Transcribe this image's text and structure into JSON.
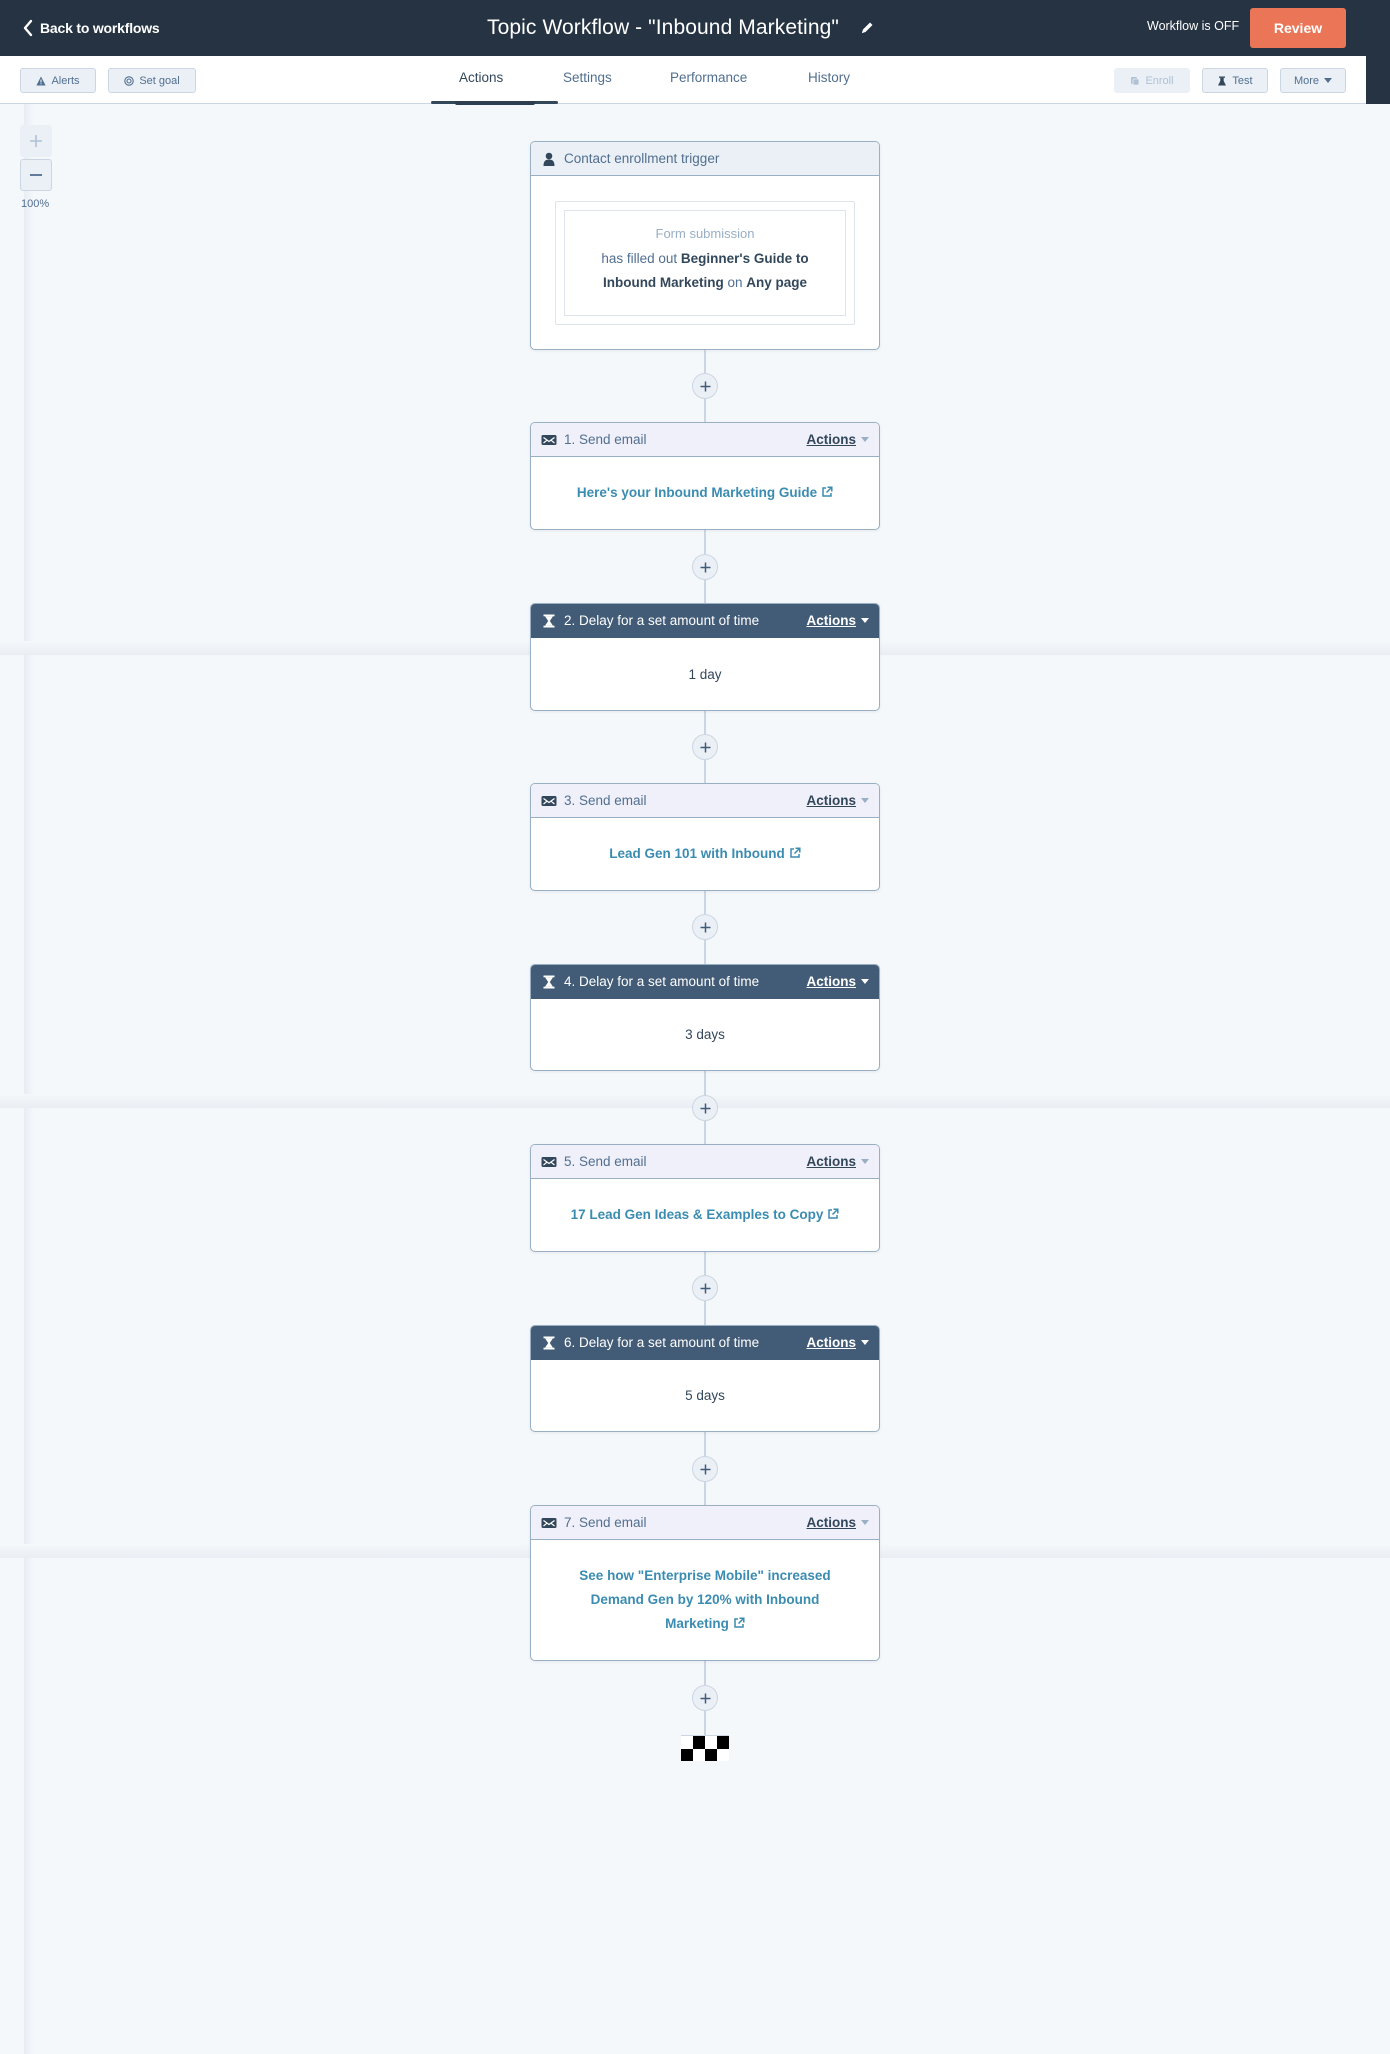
{
  "header": {
    "back_label": "Back to workflows",
    "title": "Topic Workflow - \"Inbound Marketing\"",
    "status": "Workflow is OFF",
    "review_label": "Review"
  },
  "toolbar": {
    "alerts_label": "Alerts",
    "set_goal_label": "Set goal",
    "enroll_label": "Enroll",
    "test_label": "Test",
    "more_label": "More"
  },
  "tabs": [
    {
      "label": "Actions",
      "active": true
    },
    {
      "label": "Settings",
      "active": false
    },
    {
      "label": "Performance",
      "active": false
    },
    {
      "label": "History",
      "active": false
    }
  ],
  "zoom": {
    "level": "100%"
  },
  "trigger": {
    "title": "Contact enrollment trigger",
    "type": "Form submission",
    "desc_prefix": "has filled out",
    "form_name": "Beginner's Guide to Inbound Marketing",
    "desc_mid": "on",
    "page": "Any page",
    "icon": "contact-icon"
  },
  "actions_label": "Actions",
  "steps": [
    {
      "kind": "email",
      "title": "1. Send email",
      "value": "Here's your Inbound Marketing Guide",
      "icon": "email-icon"
    },
    {
      "kind": "delay",
      "title": "2. Delay for a set amount of time",
      "value": "1 day",
      "icon": "hourglass-icon"
    },
    {
      "kind": "email",
      "title": "3. Send email",
      "value": "Lead Gen 101 with Inbound",
      "icon": "email-icon"
    },
    {
      "kind": "delay",
      "title": "4. Delay for a set amount of time",
      "value": "3 days",
      "icon": "hourglass-icon"
    },
    {
      "kind": "email",
      "title": "5. Send email",
      "value": "17 Lead Gen Ideas & Examples to Copy",
      "icon": "email-icon"
    },
    {
      "kind": "delay",
      "title": "6. Delay for a set amount of time",
      "value": "5 days",
      "icon": "hourglass-icon"
    },
    {
      "kind": "email",
      "title": "7. Send email",
      "value": "See how \"Enterprise Mobile\" increased Demand Gen by 120% with Inbound Marketing",
      "icon": "email-icon"
    }
  ],
  "colors": {
    "header_bg": "#253342",
    "review_button": "#ea7657",
    "delay_header": "#425b76",
    "email_header": "#f0f0fa",
    "link": "#3b8cb1",
    "canvas_bg": "#f5f8fa"
  }
}
